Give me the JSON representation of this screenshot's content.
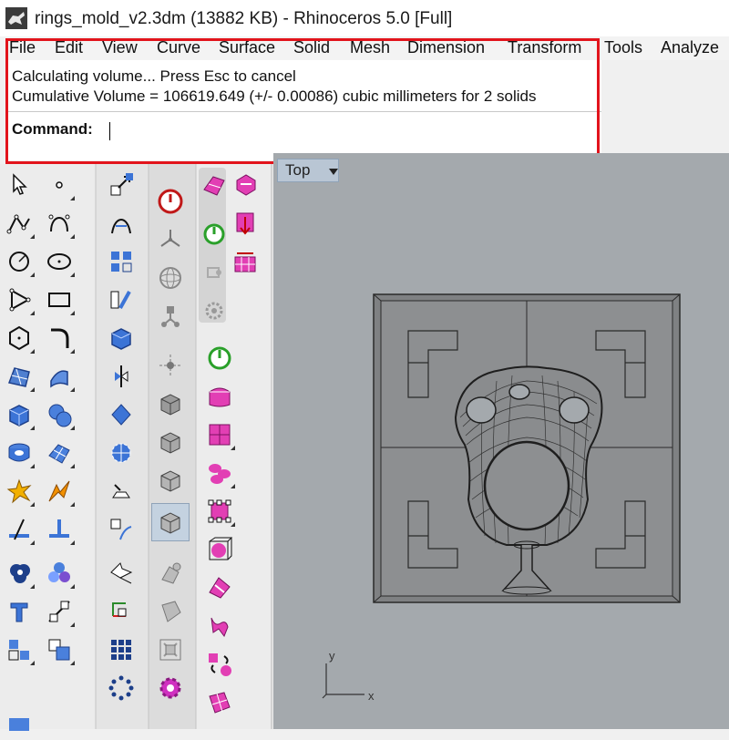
{
  "window": {
    "title": "rings_mold_v2.3dm (13882 KB) - Rhinoceros 5.0 [Full]"
  },
  "menu": {
    "items": [
      "File",
      "Edit",
      "View",
      "Curve",
      "Surface",
      "Solid",
      "Mesh",
      "Dimension",
      "Transform",
      "Tools",
      "Analyze"
    ]
  },
  "command": {
    "history": [
      "Calculating volume... Press Esc to cancel",
      "Cumulative Volume = 106619.649 (+/- 0.00086) cubic millimeters for 2 solids"
    ],
    "prompt": "Command:",
    "input_value": ""
  },
  "viewport": {
    "active_view": "Top",
    "axis_x": "x",
    "axis_y": "y"
  },
  "toolbars": {
    "main": [
      "select-arrow",
      "point",
      "polyline",
      "curve",
      "circle",
      "ellipse",
      "polygon",
      "rectangle",
      "hexagon-polygon",
      "fillet-curves",
      "surface-from-curves",
      "extrude-surface",
      "solid-box",
      "solid-sphere",
      "cylinder-solid",
      "mesh-surface",
      "explode",
      "split",
      "trim",
      "join",
      "boolean-union",
      "boolean-difference",
      "dimension-text",
      "offset-curve",
      "group",
      "array",
      "block"
    ],
    "second": [
      "move",
      "rotate-control-points",
      "scale",
      "curve-tools",
      "box-edit",
      "gumball",
      "surface-edit",
      "curve-on-surface",
      "polyline-on-mesh",
      "grid-array",
      "polar-array"
    ],
    "third": [
      "power-off",
      "radial-snap",
      "sphere-snap",
      "vertex-snap",
      "smart-track",
      "cube-1",
      "cube-2",
      "cube-3",
      "cube-4",
      "mesh-tool",
      "blend-tool",
      "mesh-repair",
      "gear"
    ],
    "fourth": [
      "render-material",
      "power-on",
      "record-history",
      "settings-gear",
      "lighting",
      "material-cube",
      "multi-cube",
      "pink-shapes",
      "pink-grid",
      "sphere-in-cube",
      "pink-wings",
      "pink-chair",
      "pink-cycle",
      "pink-grid-surface"
    ]
  },
  "colors": {
    "highlight": "#e2141c",
    "viewport_bg": "#a4a9ad",
    "model_fill": "#8d8f91",
    "rhino_pink": "#e23fb4"
  }
}
